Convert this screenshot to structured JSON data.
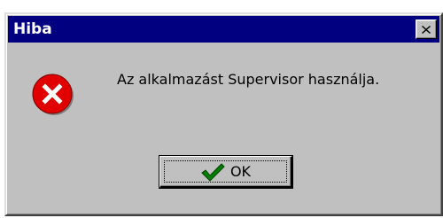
{
  "dialog": {
    "title": "Hiba",
    "message": "Az alkalmazást Supervisor használja.",
    "ok_label": "OK",
    "icons": {
      "error": "error-icon",
      "close": "close-icon",
      "ok": "checkmark-icon"
    },
    "colors": {
      "titlebar": "#000080",
      "face": "#c0c0c0",
      "error": "#e00000",
      "check": "#008000"
    }
  }
}
